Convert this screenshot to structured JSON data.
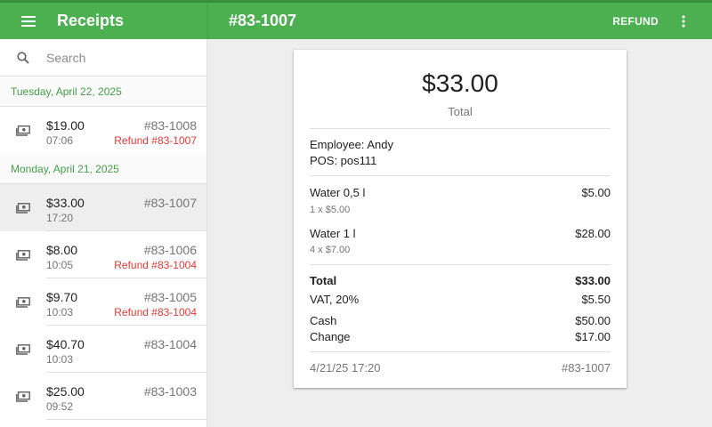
{
  "colors": {
    "primary": "#4caf50",
    "primary_dark": "#388e3c",
    "accent_green_text": "#43a047",
    "refund_red": "#e53935"
  },
  "appbar": {
    "left_title": "Receipts",
    "right_title": "#83-1007",
    "refund_label": "REFUND",
    "icons": [
      "menu-icon",
      "more-vert-icon"
    ]
  },
  "search": {
    "placeholder": "Search",
    "value": ""
  },
  "groups": [
    {
      "date": "Tuesday, April 22, 2025",
      "items": [
        {
          "amount": "$19.00",
          "time": "07:06",
          "number": "#83-1008",
          "refund": "Refund #83-1007"
        }
      ]
    },
    {
      "date": "Monday, April 21, 2025",
      "items": [
        {
          "amount": "$33.00",
          "time": "17:20",
          "number": "#83-1007",
          "refund": ""
        },
        {
          "amount": "$8.00",
          "time": "10:05",
          "number": "#83-1006",
          "refund": "Refund #83-1004"
        },
        {
          "amount": "$9.70",
          "time": "10:03",
          "number": "#83-1005",
          "refund": "Refund #83-1004"
        },
        {
          "amount": "$40.70",
          "time": "10:03",
          "number": "#83-1004",
          "refund": ""
        },
        {
          "amount": "$25.00",
          "time": "09:52",
          "number": "#83-1003",
          "refund": ""
        }
      ]
    }
  ],
  "receipt": {
    "total": "$33.00",
    "total_label": "Total",
    "employee": "Employee: Andy",
    "pos": "POS: pos111",
    "lines": [
      {
        "name": "Water 0,5 l",
        "price": "$5.00",
        "detail": "1 x $5.00"
      },
      {
        "name": "Water 1 l",
        "price": "$28.00",
        "detail": "4 x $7.00"
      }
    ],
    "summary_total_label": "Total",
    "summary_total_value": "$33.00",
    "vat_label": "VAT, 20%",
    "vat_value": "$5.50",
    "cash_label": "Cash",
    "cash_value": "$50.00",
    "change_label": "Change",
    "change_value": "$17.00",
    "datetime": "4/21/25 17:20",
    "number": "#83-1007"
  }
}
